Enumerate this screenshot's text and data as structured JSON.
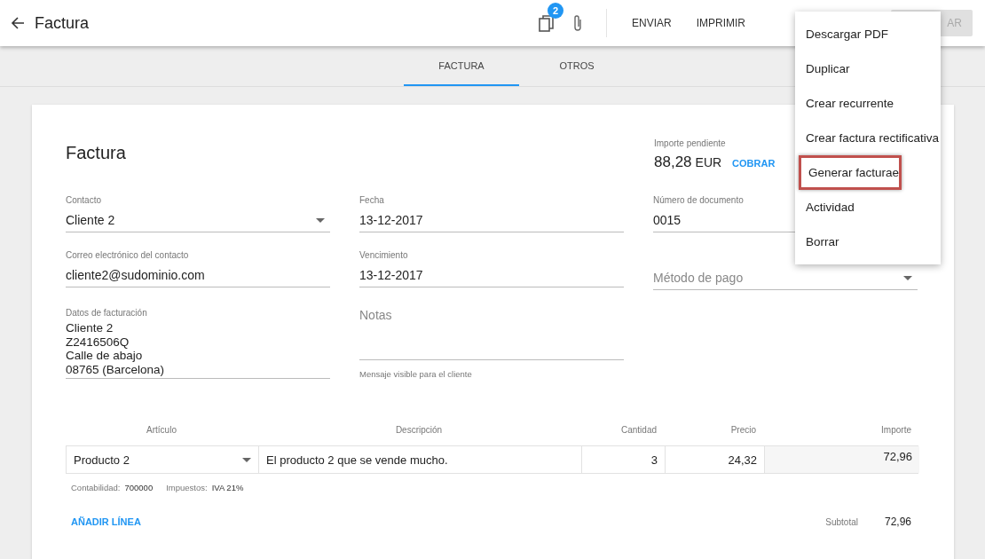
{
  "header": {
    "title": "Factura",
    "copies_badge": "2",
    "actions": [
      "ENVIAR",
      "IMPRIMIR"
    ],
    "hidden_button": "AR"
  },
  "tabs": [
    {
      "label": "FACTURA",
      "selected": true
    },
    {
      "label": "OTROS",
      "selected": false
    }
  ],
  "menu": [
    {
      "label": "Descargar PDF",
      "selected": false
    },
    {
      "label": "Duplicar",
      "selected": false
    },
    {
      "label": "Crear recurrente",
      "selected": false
    },
    {
      "label": "Crear factura rectificativa",
      "selected": false
    },
    {
      "label": "Generar facturae",
      "selected": true
    },
    {
      "label": "Actividad",
      "selected": false
    },
    {
      "label": "Borrar",
      "selected": false
    }
  ],
  "card": {
    "title": "Factura",
    "pending_label": "Importe pendiente",
    "pending_amount": "88,28",
    "pending_currency": "EUR",
    "collect": "COBRAR"
  },
  "fields": [
    {
      "label": "Contacto",
      "value": "Cliente 2",
      "kind": "select"
    },
    {
      "label": "Fecha",
      "value": "13-12-2017",
      "kind": "text"
    },
    {
      "label": "Número de documento",
      "value": "0015",
      "kind": "text"
    },
    {
      "label": "Correo electrónico del contacto",
      "value": "cliente2@sudominio.com",
      "kind": "text"
    },
    {
      "label": "Vencimiento",
      "value": "13-12-2017",
      "kind": "text"
    },
    {
      "placeholder": "Método de pago",
      "kind": "select"
    },
    {
      "label": "Datos de facturación",
      "lines": [
        "Cliente 2",
        "Z2416506Q",
        "Calle de abajo",
        "08765  (Barcelona)"
      ],
      "kind": "multiline"
    },
    {
      "placeholder": "Notas",
      "hint": "Mensaje visible para el cliente",
      "kind": "textarea"
    }
  ],
  "lines": {
    "columns": [
      "Artículo",
      "Descripción",
      "Cantidad",
      "Precio",
      "Importe"
    ],
    "rows": [
      {
        "article": "Producto 2",
        "description": "El producto 2 que se vende mucho.",
        "quantity": "3",
        "price": "24,32",
        "amount": "72,96",
        "accounting_label": "Contabilidad:",
        "accounting": "700000",
        "tax_label": "Impuestos:",
        "tax": "IVA 21%"
      }
    ],
    "add_line": "AÑADIR LÍNEA",
    "subtotal_label": "Subtotal",
    "subtotal": "72,96"
  }
}
